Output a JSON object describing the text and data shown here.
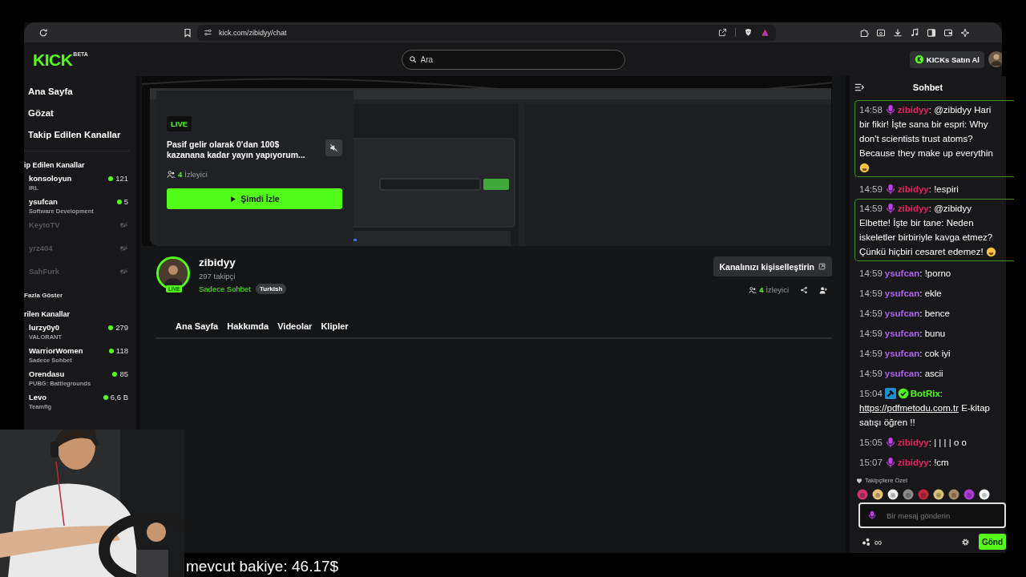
{
  "browser": {
    "url": "kick.com/zibidyy/chat"
  },
  "header": {
    "logo": "KICK",
    "logo_badge": "BETA",
    "search": {
      "placeholder": "Ara"
    },
    "buy_button": "KICKs Satın Al"
  },
  "sidebar": {
    "nav": [
      "Ana Sayfa",
      "Gözat",
      "Takip Edilen Kanallar"
    ],
    "followed_heading": "ip Edilen Kanallar",
    "followed": [
      {
        "name": "konsoloyun",
        "category": "IRL",
        "viewers": "121",
        "live": true
      },
      {
        "name": "ysufcan",
        "category": "Software Development",
        "viewers": "5",
        "live": true
      },
      {
        "name": "KeytoTV",
        "live": false
      },
      {
        "name": "yrz404",
        "live": false
      },
      {
        "name": "SahFurk",
        "live": false
      }
    ],
    "show_more": "Fazla Göster",
    "recommended_heading": "rilen Kanallar",
    "recommended": [
      {
        "name": "lurzy0y0",
        "category": "VALORANT",
        "viewers": "279",
        "live": true
      },
      {
        "name": "WarriorWomen",
        "category": "Sadece Sohbet",
        "viewers": "118",
        "live": true
      },
      {
        "name": "Orendasu",
        "category": "PUBG: Battlegrounds",
        "viewers": "85",
        "live": true
      },
      {
        "name": "Levo",
        "category": "Teamfig",
        "viewers": "6,6 B",
        "live": true
      }
    ]
  },
  "player": {
    "kind": "picture",
    "card": {
      "badge": "LIVE",
      "title": "Pasif gelir olarak 0'dan 100$ kazanana kadar yayın yapıyorum...",
      "viewers_count": "4",
      "viewers_label": "İzleyici",
      "watch_button": "Şimdi İzle",
      "muted": true
    }
  },
  "channel": {
    "name": "zibidyy",
    "followers": "297 takipçi",
    "live_badge": "LIVE",
    "category": "Sadece Sohbet",
    "tag": "Turkish",
    "customize_button": "Kanalınızı kişiselleştirin",
    "viewers_count": "4",
    "viewers_label": "İzleyici"
  },
  "tabs": [
    "Ana Sayfa",
    "Hakkımda",
    "Videolar",
    "Klipler"
  ],
  "chat": {
    "title": "Sohbet",
    "messages": [
      {
        "time": "14:58",
        "badges": [
          {
            "kind": "mic"
          }
        ],
        "user": "zibidyy",
        "color": "#e3265f",
        "text": ": @zibidyy Hari\nbir fikir! İşte sana bir espri: Why\ndon't scientists trust atoms?\nBecause they make up everythin",
        "emote": {
          "kind": "newline"
        },
        "highlighted": true
      },
      {
        "time": "14:59",
        "badges": [
          {
            "kind": "mic"
          }
        ],
        "user": "zibidyy",
        "color": "#e3265f",
        "text": ": !espiri",
        "highlighted": false
      },
      {
        "time": "14:59",
        "badges": [
          {
            "kind": "mic"
          }
        ],
        "user": "zibidyy",
        "color": "#e3265f",
        "text": ": @zibidyy\nElbette! İşte bir tane: Neden\niskeletler birbiriyle kavga etmez?\nÇünkü hiçbiri cesaret edemez!",
        "emote": {
          "kind": "inline"
        },
        "highlighted": true
      },
      {
        "time": "14:59",
        "user": "ysufcan",
        "color": "#b25ff2",
        "text": ": !porno",
        "highlighted": false
      },
      {
        "time": "14:59",
        "user": "ysufcan",
        "color": "#b25ff2",
        "text": ": ekle",
        "highlighted": false
      },
      {
        "time": "14:59",
        "user": "ysufcan",
        "color": "#b25ff2",
        "text": ": bence",
        "highlighted": false
      },
      {
        "time": "14:59",
        "user": "ysufcan",
        "color": "#b25ff2",
        "text": ": bunu",
        "highlighted": false
      },
      {
        "time": "14:59",
        "user": "ysufcan",
        "color": "#b25ff2",
        "text": ": cok iyi",
        "highlighted": false
      },
      {
        "time": "14:59",
        "user": "ysufcan",
        "color": "#b25ff2",
        "text": ": ascii",
        "highlighted": false
      },
      {
        "time": "15:04",
        "badges": [
          {
            "kind": "hammer"
          },
          {
            "kind": "verified"
          }
        ],
        "user": "BotRix",
        "color": "#53fc18",
        "text": ":",
        "link": "https://pdfmetodu.com.tr",
        "text_after": " E-kitap\nsatışı öğren !!",
        "highlighted": false
      },
      {
        "time": "15:05",
        "badges": [
          {
            "kind": "mic"
          }
        ],
        "user": "zibidyy",
        "color": "#e3265f",
        "text": ": | | | | o o",
        "highlighted": false
      },
      {
        "time": "15:07",
        "badges": [
          {
            "kind": "mic"
          }
        ],
        "user": "zibidyy",
        "color": "#e3265f",
        "text": ": !cm",
        "highlighted": false
      }
    ],
    "followers_only": "Takipçilere Özel",
    "input": {
      "placeholder": "Bir mesaj gönderin"
    },
    "infinity": "∞",
    "send_button": "Gönd"
  },
  "overlay_caption": "mevcut bakiye: 46.17$"
}
